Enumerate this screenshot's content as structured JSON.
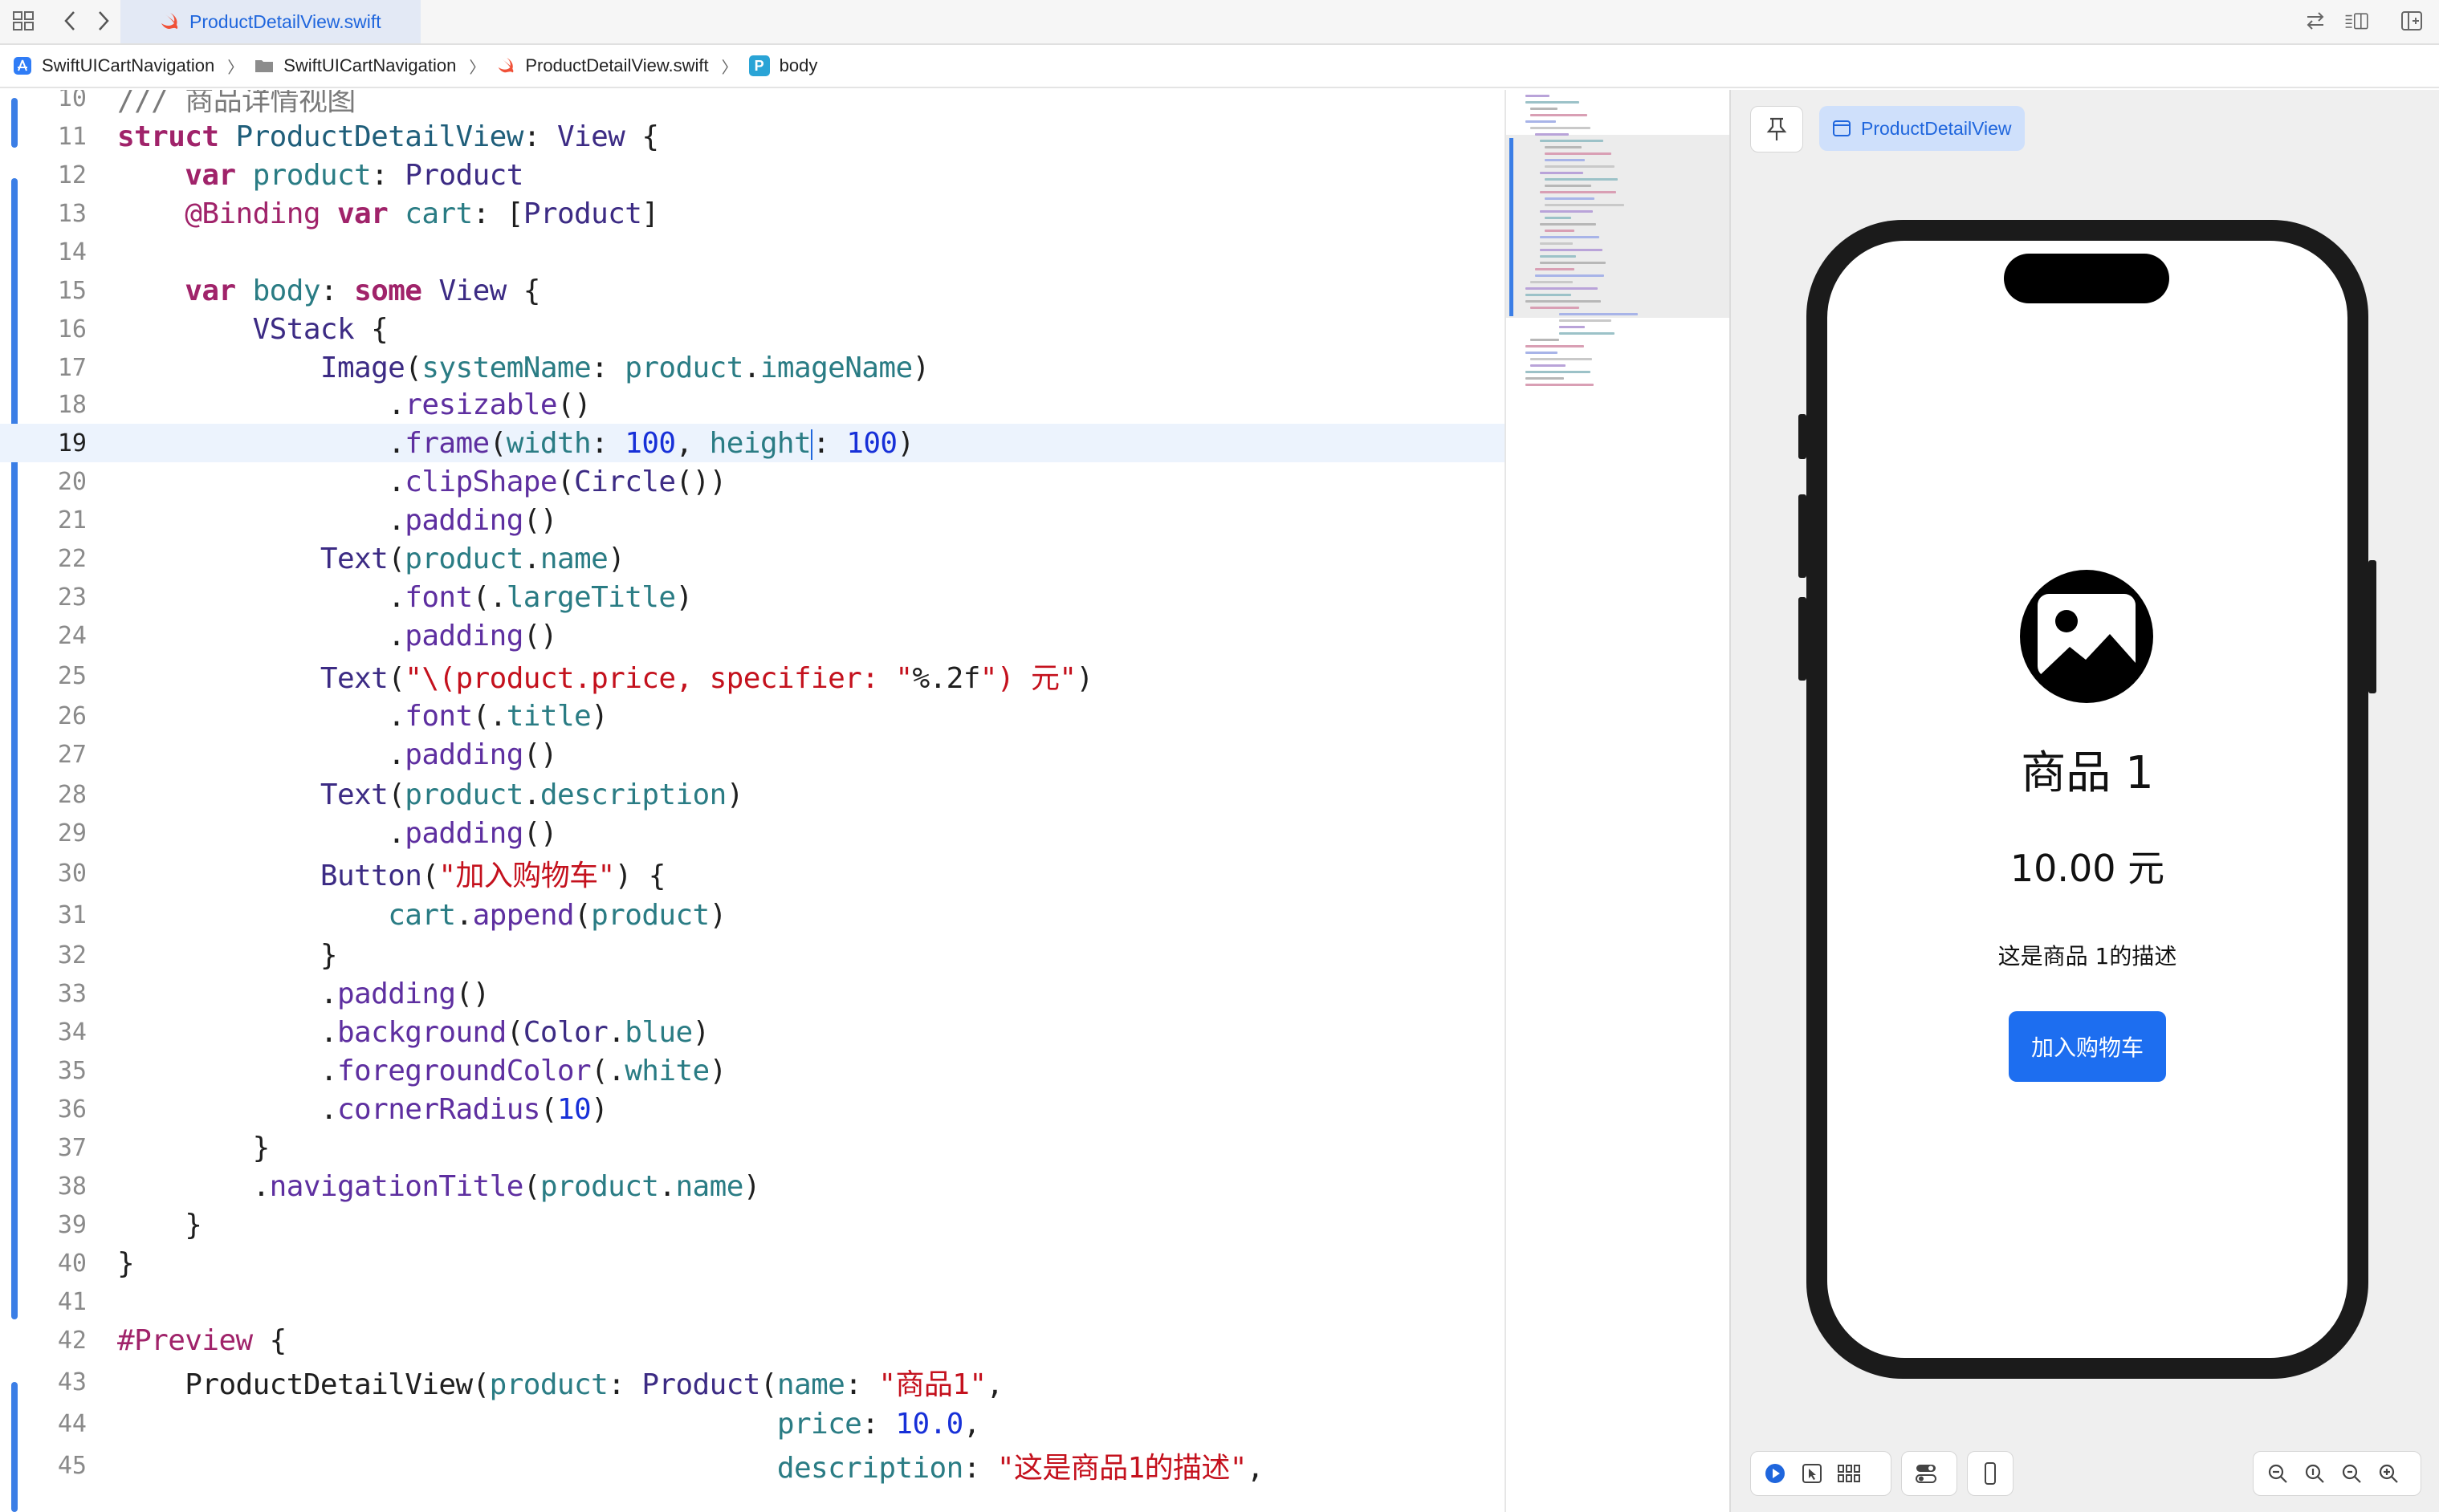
{
  "tab": {
    "file_name": "ProductDetailView.swift"
  },
  "breadcrumb": {
    "project": "SwiftUICartNavigation",
    "folder": "SwiftUICartNavigation",
    "file": "ProductDetailView.swift",
    "symbol": "body",
    "symbol_badge": "P"
  },
  "editor": {
    "current_line": 19,
    "lines": [
      {
        "n": "10",
        "code": "/// 商品详情视图"
      },
      {
        "n": "11",
        "code": "struct ProductDetailView: View {"
      },
      {
        "n": "12",
        "code": "    var product: Product"
      },
      {
        "n": "13",
        "code": "    @Binding var cart: [Product]"
      },
      {
        "n": "14",
        "code": ""
      },
      {
        "n": "15",
        "code": "    var body: some View {"
      },
      {
        "n": "16",
        "code": "        VStack {"
      },
      {
        "n": "17",
        "code": "            Image(systemName: product.imageName)"
      },
      {
        "n": "18",
        "code": "                .resizable()"
      },
      {
        "n": "19",
        "code": "                .frame(width: 100, height: 100)"
      },
      {
        "n": "20",
        "code": "                .clipShape(Circle())"
      },
      {
        "n": "21",
        "code": "                .padding()"
      },
      {
        "n": "22",
        "code": "            Text(product.name)"
      },
      {
        "n": "23",
        "code": "                .font(.largeTitle)"
      },
      {
        "n": "24",
        "code": "                .padding()"
      },
      {
        "n": "25",
        "code": "            Text(\"\\(product.price, specifier: \"%.2f\") 元\")"
      },
      {
        "n": "26",
        "code": "                .font(.title)"
      },
      {
        "n": "27",
        "code": "                .padding()"
      },
      {
        "n": "28",
        "code": "            Text(product.description)"
      },
      {
        "n": "29",
        "code": "                .padding()"
      },
      {
        "n": "30",
        "code": "            Button(\"加入购物车\") {"
      },
      {
        "n": "31",
        "code": "                cart.append(product)"
      },
      {
        "n": "32",
        "code": "            }"
      },
      {
        "n": "33",
        "code": "            .padding()"
      },
      {
        "n": "34",
        "code": "            .background(Color.blue)"
      },
      {
        "n": "35",
        "code": "            .foregroundColor(.white)"
      },
      {
        "n": "36",
        "code": "            .cornerRadius(10)"
      },
      {
        "n": "37",
        "code": "        }"
      },
      {
        "n": "38",
        "code": "        .navigationTitle(product.name)"
      },
      {
        "n": "39",
        "code": "    }"
      },
      {
        "n": "40",
        "code": "}"
      },
      {
        "n": "41",
        "code": ""
      },
      {
        "n": "42",
        "code": "#Preview {"
      },
      {
        "n": "43",
        "code": "    ProductDetailView(product: Product(name: \"商品1\","
      },
      {
        "n": "44",
        "code": "                                       price: 10.0,"
      },
      {
        "n": "45",
        "code": "                                       description: \"这是商品1的描述\","
      }
    ]
  },
  "preview": {
    "chip_label": "ProductDetailView",
    "product_name": "商品 1",
    "price_text": "10.00 元",
    "description": "这是商品 1的描述",
    "button_label": "加入购物车"
  },
  "colors": {
    "accent": "#1f66dd",
    "button_blue": "#1d6ef0",
    "keyword": "#a0236a",
    "string": "#c4111d",
    "number": "#1730d8"
  },
  "icons": {
    "top_left": [
      "grid-icon",
      "back-chevron-icon",
      "forward-chevron-icon"
    ],
    "top_right": [
      "swap-icon",
      "editor-options-icon",
      "add-editor-icon"
    ],
    "canvas_bottom": [
      "live-preview-icon",
      "selectable-icon",
      "variants-icon",
      "device-settings-icon",
      "device-icon",
      "zoom-out-icon",
      "zoom-100-icon",
      "zoom-fit-icon",
      "zoom-in-icon"
    ]
  }
}
